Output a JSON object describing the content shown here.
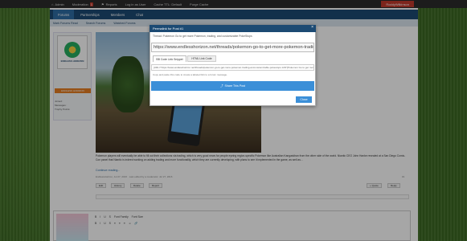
{
  "adminbar": {
    "items": [
      "Admin",
      "Moderation",
      "Reports",
      "Log in as User",
      "Cache TTL: Default",
      "Purge Cache"
    ],
    "badge": "1",
    "user": "RoddyWilkinson"
  },
  "navbar": {
    "tabs": [
      "Forums",
      "Partnerships",
      "Members",
      "Chat"
    ]
  },
  "subnav": {
    "items": [
      "Mark Forums Read",
      "Search Forums",
      "Watched Forums"
    ]
  },
  "userblock": {
    "logo_text": "ENDLESS HORIZON",
    "badge": "ENDLESS HORIZON",
    "stats": [
      {
        "label": "Joined:",
        "value": ""
      },
      {
        "label": "Messages:",
        "value": ""
      },
      {
        "label": "Trophy Points:",
        "value": ""
      }
    ]
  },
  "post": {
    "body": "Pokemon players will eventually be able to fill out their collections via trading, which is very good news for people eyeing region-specific Pokemon like Australian Kangaskhan from the other side of the world. Niantic CEO John Hanke revealed at a San Diego Comic-Con panel that Niantic is indeed working on adding trading and more functionality, which they are currently developing, with plans to see it implemented in the game, as well as...",
    "continue": "Continue reading...",
    "meta": "EndlessHorizon, Jul 27, 2016 · Last edited by a moderator: Jul 27, 2016",
    "number": "#1",
    "buttons": [
      "Edit",
      "History",
      "Delete",
      "Report"
    ],
    "right_buttons": [
      "+ Quote",
      "Reply"
    ]
  },
  "editor": {
    "toolbar_row1": [
      "B",
      "I",
      "U",
      "S",
      "Font Family",
      "Font Size"
    ],
    "toolbar_row2": [
      "B",
      "I",
      "U",
      "S",
      "≡",
      "≡",
      "≡",
      "☺",
      "🔗"
    ]
  },
  "modal": {
    "title": "Permalink for Post #1",
    "close_x": "×",
    "description": "Thread: Pokemon Go to get more Pokemon, trading, and customizable PokeStops",
    "url": "https://www.endlesshorizon.net/threads/pokemon-go-to-get-more-pokemon-trading-and-customizable-pokestops.123/",
    "tabs": [
      "BB Code Link Snippet",
      "HTML Link Code"
    ],
    "code": "[URL=\"https://www.endlesshorizon.net/threads/pokemon-go-to-get-more-pokemon-trading-and-customizable-pokestops.123/\"]Pokemon Go to get more Pokemon, trading, and customizable PokeStops[/URL]",
    "hint": "Copy and paste this code to create a labeled link to a forum message.",
    "share": "Share This Post",
    "close": "Close"
  },
  "colors": {
    "navbar": "#1c4a73",
    "accent": "#3b8fd8",
    "badge": "#c0392b"
  }
}
